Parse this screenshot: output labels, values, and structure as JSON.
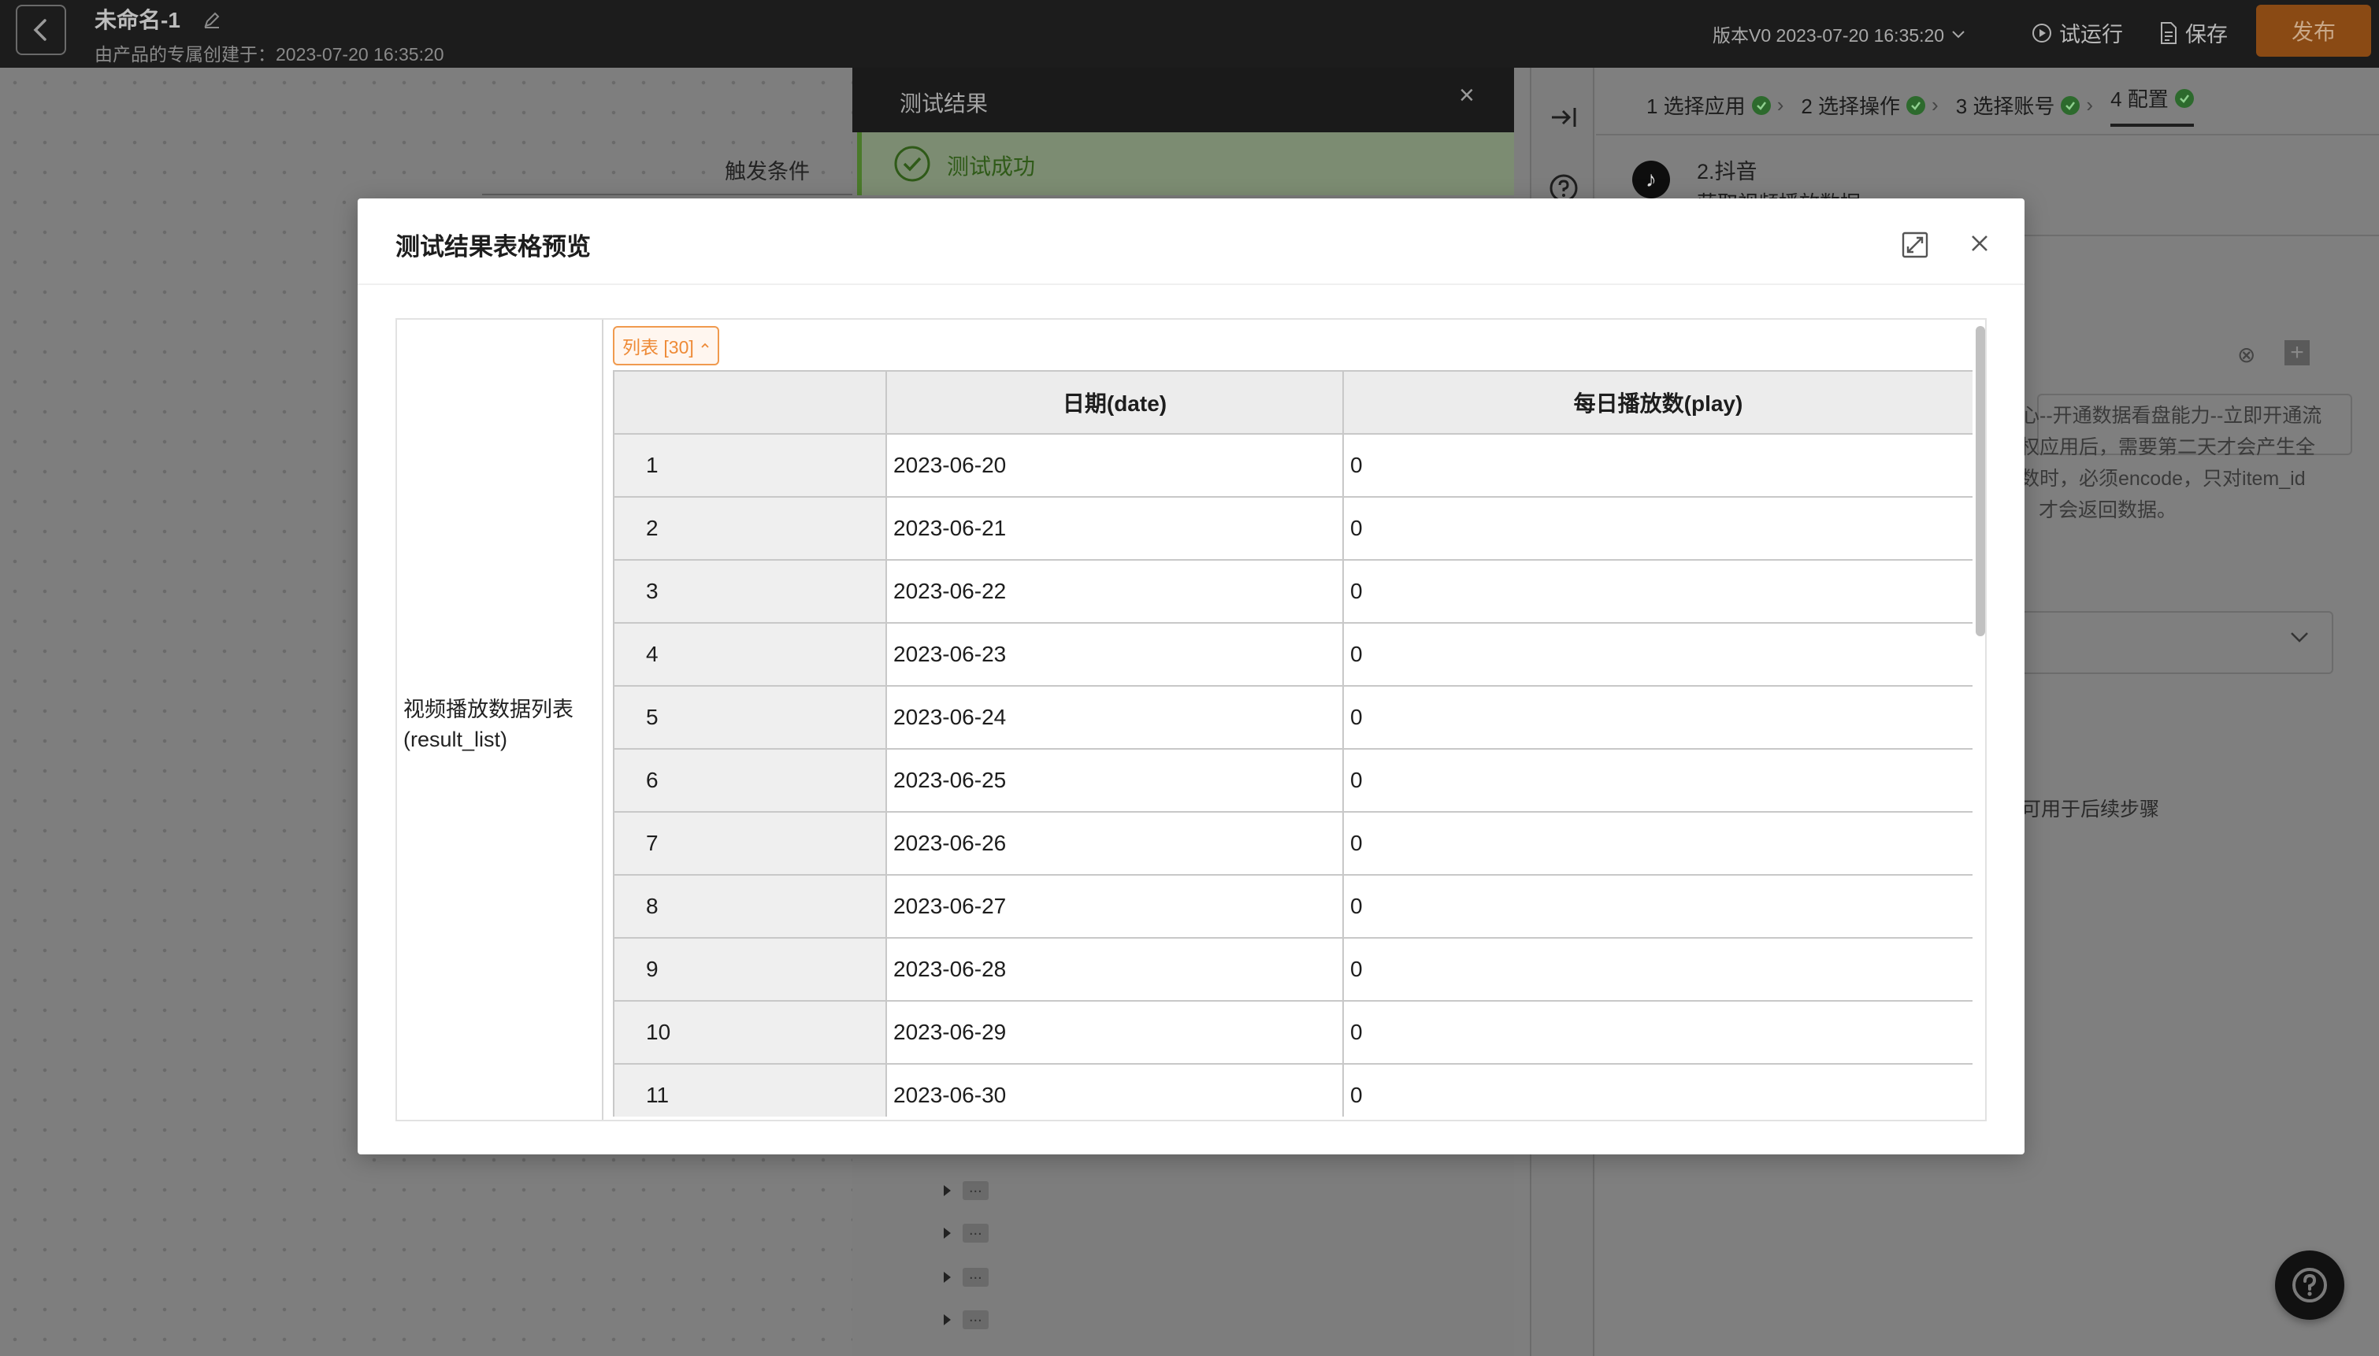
{
  "topbar": {
    "title": "未命名-1",
    "subtitle": "由产品的专属创建于：2023-07-20 16:35:20",
    "version": "版本V0 2023-07-20 16:35:20",
    "test_run": "试运行",
    "save": "保存",
    "publish": "发布"
  },
  "canvas": {
    "trigger_label": "触发条件"
  },
  "result_panel": {
    "title": "测试结果",
    "success": "测试成功",
    "tree_items": [
      "...",
      "...",
      "...",
      "..."
    ]
  },
  "config": {
    "steps": [
      {
        "label": "1 选择应用",
        "done": true
      },
      {
        "label": "2 选择操作",
        "done": true
      },
      {
        "label": "3 选择账号",
        "done": true
      },
      {
        "label": "4 配置",
        "done": true
      }
    ],
    "app_name": "2.抖音",
    "app_action": "获取视频播放数据",
    "field_tip_lines": [
      "心--开通数据看盘能力--立即开通流",
      "权应用后，需要第二天才会产生全",
      "数时，必须encode，只对item_id",
      "才会返回数据。"
    ],
    "output_tip": "可用于后续步骤"
  },
  "modal": {
    "title": "测试结果表格预览",
    "field_label_line1": "视频播放数据列表",
    "field_label_line2": "(result_list)",
    "list_tag": "列表 [30]",
    "columns": [
      "",
      "日期(date)",
      "每日播放数(play)"
    ],
    "rows": [
      {
        "index": "1",
        "date": "2023-06-20",
        "play": "0"
      },
      {
        "index": "2",
        "date": "2023-06-21",
        "play": "0"
      },
      {
        "index": "3",
        "date": "2023-06-22",
        "play": "0"
      },
      {
        "index": "4",
        "date": "2023-06-23",
        "play": "0"
      },
      {
        "index": "5",
        "date": "2023-06-24",
        "play": "0"
      },
      {
        "index": "6",
        "date": "2023-06-25",
        "play": "0"
      },
      {
        "index": "7",
        "date": "2023-06-26",
        "play": "0"
      },
      {
        "index": "8",
        "date": "2023-06-27",
        "play": "0"
      },
      {
        "index": "9",
        "date": "2023-06-28",
        "play": "0"
      },
      {
        "index": "10",
        "date": "2023-06-29",
        "play": "0"
      },
      {
        "index": "11",
        "date": "2023-06-30",
        "play": "0"
      }
    ]
  },
  "colors": {
    "accent": "#ee8a36",
    "publish": "#c2690f",
    "success": "#4caf50"
  },
  "icons": [
    "back-arrow-icon",
    "edit-icon",
    "play-circle-icon",
    "document-icon",
    "chevron-down-icon",
    "close-icon",
    "check-circle-icon",
    "collapse-right-icon",
    "question-icon",
    "douyin-logo-icon",
    "expand-icon",
    "clear-icon",
    "plus-icon",
    "help-icon",
    "caret-up-icon"
  ]
}
